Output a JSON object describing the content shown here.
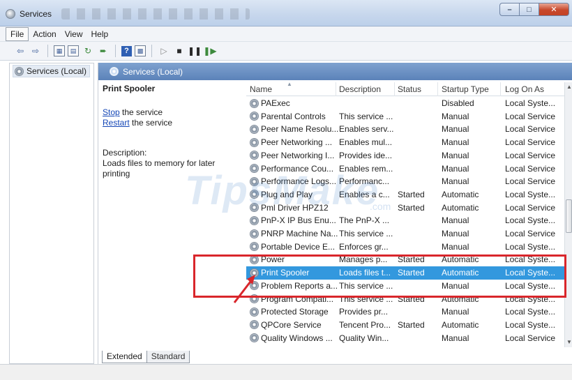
{
  "window": {
    "title": "Services"
  },
  "menu": {
    "file": "File",
    "action": "Action",
    "view": "View",
    "help": "Help"
  },
  "toolbar": {
    "icons": [
      "back-arrow-icon",
      "forward-arrow-icon",
      "console-tree-icon",
      "properties-icon",
      "refresh-icon",
      "export-icon",
      "help-icon",
      "show-hide-icon",
      "play-icon",
      "stop-icon",
      "pause-icon",
      "resume-icon"
    ]
  },
  "tree": {
    "root_label": "Services (Local)"
  },
  "pane": {
    "header": "Services (Local)"
  },
  "details": {
    "service_name": "Print Spooler",
    "stop_link": "Stop",
    "stop_suffix": " the service",
    "restart_link": "Restart",
    "restart_suffix": " the service",
    "description_label": "Description:",
    "description_line1": "Loads files to memory for later",
    "description_line2": "printing"
  },
  "columns": {
    "name": "Name",
    "description": "Description",
    "status": "Status",
    "startup_type": "Startup Type",
    "log_on_as": "Log On As"
  },
  "rows": [
    {
      "name": "PAExec",
      "description": "",
      "status": "",
      "startup": "Disabled",
      "logon": "Local Syste..."
    },
    {
      "name": "Parental Controls",
      "description": "This service ...",
      "status": "",
      "startup": "Manual",
      "logon": "Local Service"
    },
    {
      "name": "Peer Name Resolu...",
      "description": "Enables serv...",
      "status": "",
      "startup": "Manual",
      "logon": "Local Service"
    },
    {
      "name": "Peer Networking ...",
      "description": "Enables mul...",
      "status": "",
      "startup": "Manual",
      "logon": "Local Service"
    },
    {
      "name": "Peer Networking I...",
      "description": "Provides ide...",
      "status": "",
      "startup": "Manual",
      "logon": "Local Service"
    },
    {
      "name": "Performance Cou...",
      "description": "Enables rem...",
      "status": "",
      "startup": "Manual",
      "logon": "Local Service"
    },
    {
      "name": "Performance Logs...",
      "description": "Performanc...",
      "status": "",
      "startup": "Manual",
      "logon": "Local Service"
    },
    {
      "name": "Plug and Play",
      "description": "Enables a c...",
      "status": "Started",
      "startup": "Automatic",
      "logon": "Local Syste..."
    },
    {
      "name": "Pml Driver HPZ12",
      "description": "",
      "status": "Started",
      "startup": "Automatic",
      "logon": "Local Service"
    },
    {
      "name": "PnP-X IP Bus Enu...",
      "description": "The PnP-X ...",
      "status": "",
      "startup": "Manual",
      "logon": "Local Syste..."
    },
    {
      "name": "PNRP Machine Na...",
      "description": "This service ...",
      "status": "",
      "startup": "Manual",
      "logon": "Local Service"
    },
    {
      "name": "Portable Device E...",
      "description": "Enforces gr...",
      "status": "",
      "startup": "Manual",
      "logon": "Local Syste..."
    },
    {
      "name": "Power",
      "description": "Manages p...",
      "status": "Started",
      "startup": "Automatic",
      "logon": "Local Syste..."
    },
    {
      "name": "Print Spooler",
      "description": "Loads files t...",
      "status": "Started",
      "startup": "Automatic",
      "logon": "Local Syste..."
    },
    {
      "name": "Problem Reports a...",
      "description": "This service ...",
      "status": "",
      "startup": "Manual",
      "logon": "Local Syste..."
    },
    {
      "name": "Program Compati...",
      "description": "This service ...",
      "status": "Started",
      "startup": "Automatic",
      "logon": "Local Syste..."
    },
    {
      "name": "Protected Storage",
      "description": "Provides pr...",
      "status": "",
      "startup": "Manual",
      "logon": "Local Syste..."
    },
    {
      "name": "QPCore Service",
      "description": "Tencent Pro...",
      "status": "Started",
      "startup": "Automatic",
      "logon": "Local Syste..."
    },
    {
      "name": "Quality Windows ...",
      "description": "Quality Win...",
      "status": "",
      "startup": "Manual",
      "logon": "Local Service"
    }
  ],
  "selected_row": "Print Spooler",
  "tabs": {
    "extended": "Extended",
    "standard": "Standard"
  },
  "watermark": {
    "text": "TipsMake",
    "suffix": ".com"
  },
  "colors": {
    "selection": "#3398de",
    "annotation": "#d9262b",
    "pane_header": "#6a8fc4"
  }
}
